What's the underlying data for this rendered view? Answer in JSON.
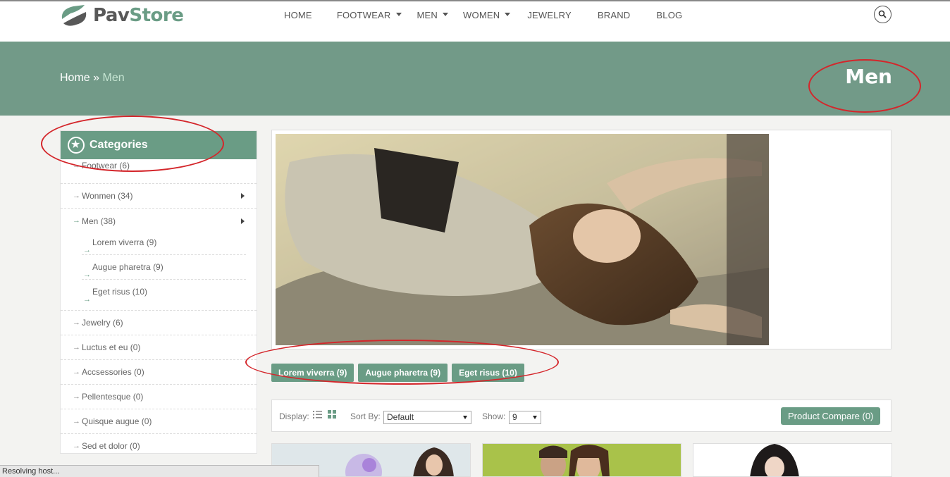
{
  "brand": {
    "part1": "Pav",
    "part2": "Store"
  },
  "nav": {
    "items": [
      {
        "label": "HOME",
        "dropdown": false
      },
      {
        "label": "FOOTWEAR",
        "dropdown": true
      },
      {
        "label": "MEN",
        "dropdown": true
      },
      {
        "label": "WOMEN",
        "dropdown": true
      },
      {
        "label": "JEWELRY",
        "dropdown": false
      },
      {
        "label": "BRAND",
        "dropdown": false
      },
      {
        "label": "BLOG",
        "dropdown": false
      }
    ],
    "search_icon": "search-icon"
  },
  "banner": {
    "breadcrumb_home": "Home",
    "breadcrumb_sep": "»",
    "breadcrumb_current": "Men",
    "title": "Men"
  },
  "sidebar": {
    "heading": "Categories",
    "heading_icon": "star-icon",
    "items": [
      {
        "label": "Footwear (6)"
      },
      {
        "label": "Wonmen (34)",
        "has_children": true
      },
      {
        "label": "Men (38)",
        "has_children": true,
        "open": true,
        "children": [
          "Lorem viverra (9)",
          "Augue pharetra (9)",
          "Eget risus (10)"
        ]
      },
      {
        "label": "Jewelry (6)"
      },
      {
        "label": "Luctus et eu (0)"
      },
      {
        "label": "Accsessories (0)"
      },
      {
        "label": "Pellentesque (0)"
      },
      {
        "label": "Quisque augue (0)"
      },
      {
        "label": "Sed et dolor (0)"
      }
    ]
  },
  "subcategory_buttons": [
    "Lorem viverra (9)",
    "Augue pharetra (9)",
    "Eget risus (10)"
  ],
  "toolbar": {
    "display_label": "Display:",
    "sort_label": "Sort By:",
    "sort_value": "Default",
    "show_label": "Show:",
    "show_value": "9",
    "compare_label": "Product Compare (0)"
  },
  "status_bar": "Resolving host...",
  "colors": {
    "accent": "#6a9c85",
    "banner": "#729a88",
    "annotation": "#d4262b"
  }
}
